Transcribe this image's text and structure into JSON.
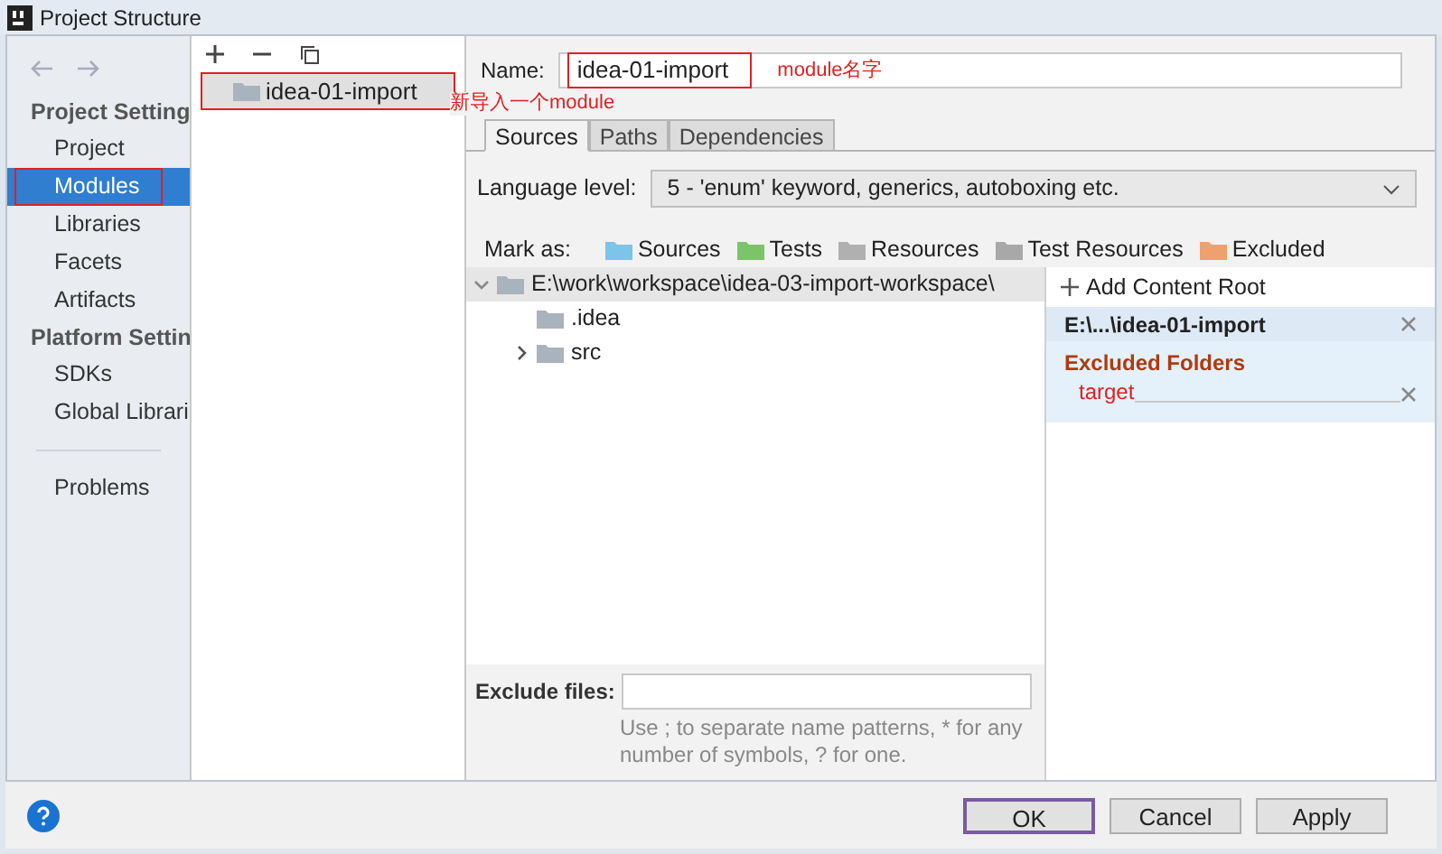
{
  "window": {
    "title": "Project Structure"
  },
  "sidebar": {
    "groups": [
      {
        "heading": "Project Setting",
        "items": [
          {
            "label": "Project",
            "selected": false
          },
          {
            "label": "Modules",
            "selected": true
          },
          {
            "label": "Libraries",
            "selected": false
          },
          {
            "label": "Facets",
            "selected": false
          },
          {
            "label": "Artifacts",
            "selected": false
          }
        ]
      },
      {
        "heading": "Platform Settin",
        "items": [
          {
            "label": "SDKs",
            "selected": false
          },
          {
            "label": "Global Librari",
            "selected": false
          }
        ]
      },
      {
        "items": [
          {
            "label": "Problems",
            "selected": false
          }
        ]
      }
    ]
  },
  "modules": {
    "items": [
      {
        "label": "idea-01-import",
        "selected": true
      }
    ]
  },
  "annotations": [
    {
      "text": "新导入一个module"
    },
    {
      "text": "module名字"
    }
  ],
  "name": {
    "label": "Name:",
    "value": "idea-01-import"
  },
  "tabs": [
    {
      "label": "Sources",
      "selected": true
    },
    {
      "label": "Paths",
      "selected": false
    },
    {
      "label": "Dependencies",
      "selected": false
    }
  ],
  "language_level": {
    "label": "Language level:",
    "value": "5 - 'enum' keyword, generics, autoboxing etc."
  },
  "mark_as": {
    "label": "Mark as:",
    "items": [
      {
        "label": "Sources",
        "color": "#7cc4e8"
      },
      {
        "label": "Tests",
        "color": "#7cc46a"
      },
      {
        "label": "Resources",
        "color": "#b0b0b0"
      },
      {
        "label": "Test Resources",
        "color": "#a8a8a8"
      },
      {
        "label": "Excluded",
        "color": "#f0a070"
      }
    ]
  },
  "tree": [
    {
      "label": "E:\\work\\workspace\\idea-03-import-workspace\\",
      "expanded": true,
      "children": [
        {
          "label": ".idea"
        },
        {
          "label": "src",
          "expanded": false
        }
      ]
    }
  ],
  "content_root": {
    "add": "Add Content Root",
    "path": "E:\\...\\idea-01-import",
    "excluded_heading": "Excluded Folders",
    "excluded": [
      "target"
    ]
  },
  "exclude_files": {
    "label": "Exclude files:",
    "hint": "Use ; to separate name patterns, * for any number of symbols, ? for one."
  },
  "buttons": [
    {
      "label": "OK",
      "default": true
    },
    {
      "label": "Cancel",
      "default": false
    },
    {
      "label": "Apply",
      "default": false
    }
  ]
}
